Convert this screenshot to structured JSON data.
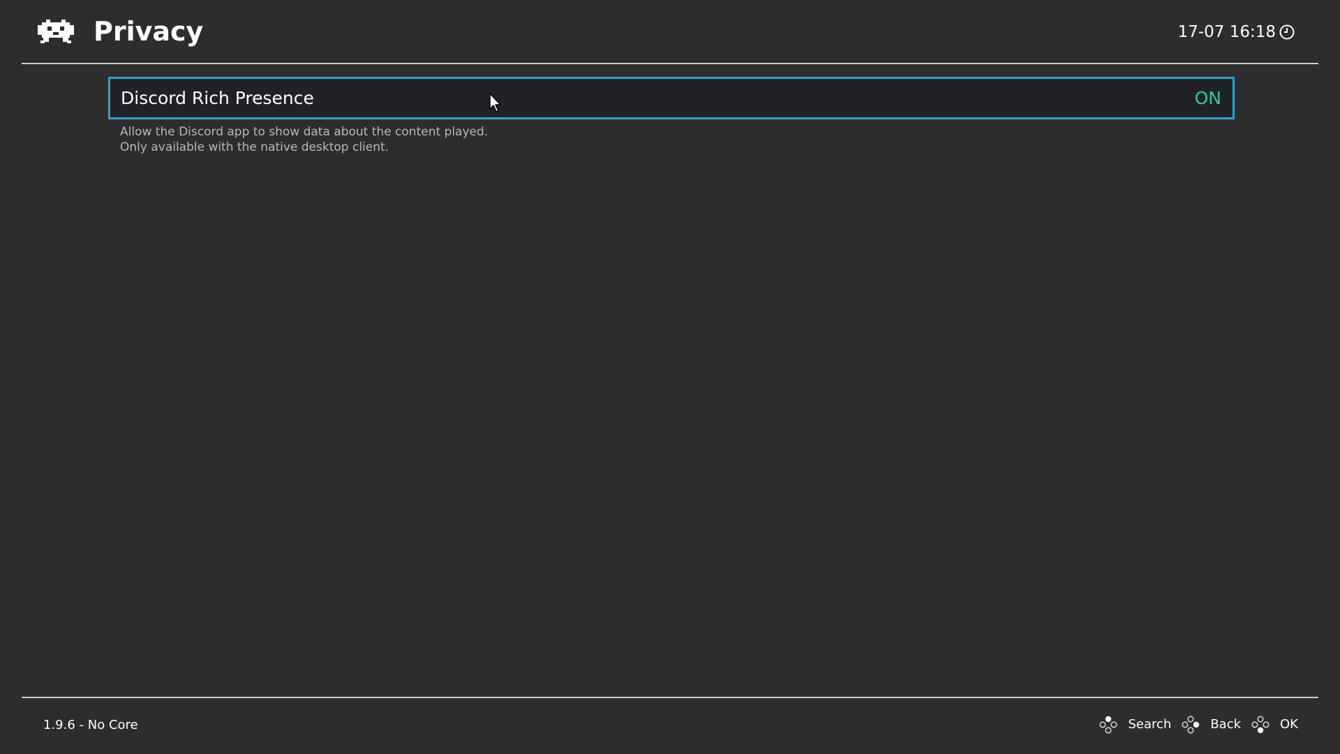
{
  "header": {
    "title": "Privacy",
    "clock": "17-07 16:18",
    "logo_icon": "retroarch-invader-icon",
    "clock_icon": "clock-icon"
  },
  "settings": {
    "items": [
      {
        "label": "Discord Rich Presence",
        "value": "ON",
        "description_line1": "Allow the Discord app to show data about the content played.",
        "description_line2": "Only available with the native desktop client."
      }
    ]
  },
  "footer": {
    "version": "1.9.6 - No Core",
    "actions": [
      {
        "label": "Search",
        "icon": "gamepad-button-top-icon"
      },
      {
        "label": "Back",
        "icon": "gamepad-button-right-icon"
      },
      {
        "label": "OK",
        "icon": "gamepad-button-bottom-icon"
      }
    ]
  },
  "colors": {
    "background": "#2d2d2d",
    "selection_border": "#2fa3c9",
    "value_on": "#1fd0a3",
    "row_background": "#212227"
  }
}
